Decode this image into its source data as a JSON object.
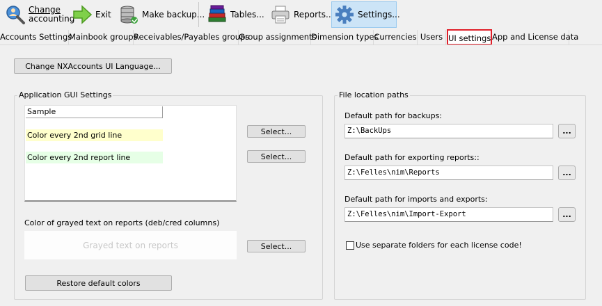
{
  "toolbar": {
    "change_accounting": {
      "line1": "Change",
      "line2": "accounting",
      "icon": "search-person-icon"
    },
    "exit": {
      "label": "Exit",
      "icon": "exit-arrow-icon"
    },
    "make_backup": {
      "label": "Make backup...",
      "icon": "database-icon"
    },
    "tables": {
      "label": "Tables...",
      "icon": "books-icon"
    },
    "reports": {
      "label": "Reports...",
      "icon": "printer-icon"
    },
    "settings": {
      "label": "Settings...",
      "icon": "gear-icon"
    }
  },
  "tabs": [
    {
      "label": "Accounts Settings"
    },
    {
      "label": "Mainbook groups"
    },
    {
      "label": "Receivables/Payables groups"
    },
    {
      "label": "Group assignments"
    },
    {
      "label": "Dimension types"
    },
    {
      "label": "Currencies"
    },
    {
      "label": "Users"
    },
    {
      "label": "UI settings",
      "selected": true
    },
    {
      "label": "App and License data"
    }
  ],
  "language_button": "Change NXAccounts UI Language...",
  "gui_settings": {
    "title": "Application GUI Settings",
    "sample_header": "Sample",
    "grid_line_label": "Color every 2nd grid line",
    "grid_line_color": "#ffffcc",
    "report_line_label": "Color every 2nd report line",
    "report_line_color": "#e6ffe6",
    "select_label": "Select...",
    "grayed_label": "Color of grayed text on reports (deb/cred columns)",
    "grayed_sample": "Grayed text on reports",
    "grayed_color": "#c8c8c8",
    "restore_button": "Restore default colors"
  },
  "file_paths": {
    "title": "File location paths",
    "backups_label": "Default path for backups:",
    "backups_value": "Z:\\BackUps",
    "reports_label": "Default path for exporting reports::",
    "reports_value": "Z:\\Felles\\nim\\Reports",
    "imports_label": "Default path for imports and exports:",
    "imports_value": "Z:\\Felles\\nim\\Import-Export",
    "browse_label": "...",
    "separate_folders_label": "Use separate folders for each license code!",
    "separate_folders_checked": false
  },
  "colors": {
    "active_tab_outline": "#e0202a",
    "active_toolbar_bg": "#cce4f7"
  }
}
